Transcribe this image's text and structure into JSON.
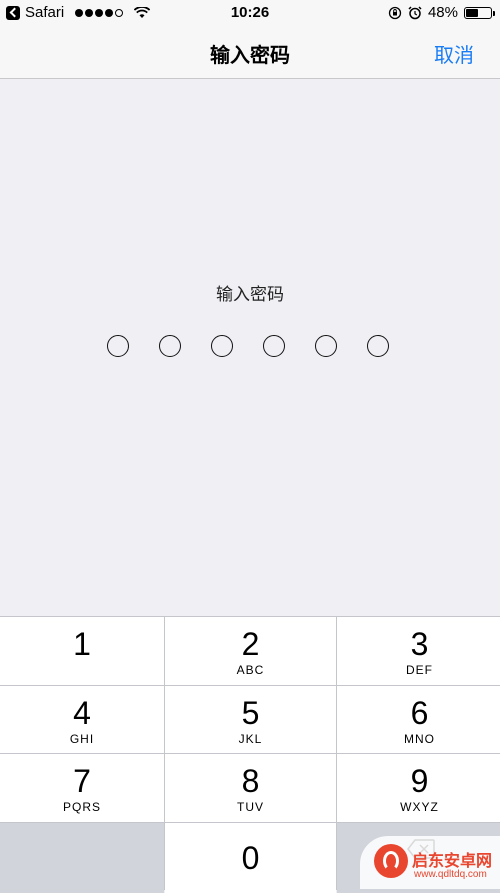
{
  "status_bar": {
    "back_app": "Safari",
    "time": "10:26",
    "battery_percent": "48%",
    "battery_level": 0.48,
    "signal_bars": 4
  },
  "nav": {
    "title": "输入密码",
    "cancel": "取消"
  },
  "passcode": {
    "prompt": "输入密码",
    "length": 6
  },
  "keypad": {
    "keys": [
      {
        "num": "1",
        "letters": ""
      },
      {
        "num": "2",
        "letters": "ABC"
      },
      {
        "num": "3",
        "letters": "DEF"
      },
      {
        "num": "4",
        "letters": "GHI"
      },
      {
        "num": "5",
        "letters": "JKL"
      },
      {
        "num": "6",
        "letters": "MNO"
      },
      {
        "num": "7",
        "letters": "PQRS"
      },
      {
        "num": "8",
        "letters": "TUV"
      },
      {
        "num": "9",
        "letters": "WXYZ"
      }
    ],
    "zero": "0"
  },
  "watermark": {
    "name": "启东安卓网",
    "url": "www.qdltdq.com"
  },
  "colors": {
    "accent": "#1a7cf5",
    "background": "#efeff4",
    "key_dark": "#d1d4db"
  }
}
